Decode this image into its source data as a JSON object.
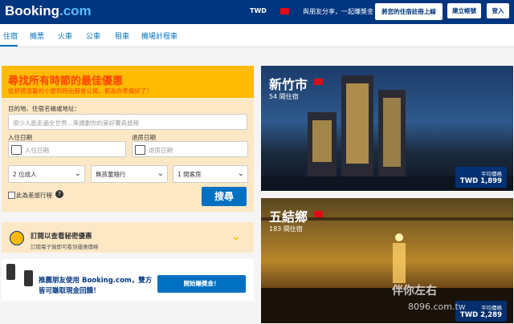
{
  "header": {
    "logo_text": "Booking",
    "logo_suffix": ".com",
    "currency": "TWD",
    "share_text": "與朋友分享，一起賺獎金",
    "list_property": "將您的住宿註冊上線",
    "register": "建立帳號",
    "login": "登入"
  },
  "nav": {
    "tabs": [
      "住宿",
      "機票",
      "火車",
      "公車",
      "租車",
      "機場計程車"
    ]
  },
  "search": {
    "title": "尋找所有時節的最佳優惠",
    "subtitle": "從舒適溫馨的小屋到時尚都會公寓，都為你準備好了！",
    "destination_label": "目的地、住宿名稱或地址：",
    "destination_placeholder": "很少人能走遍全世界...來規劃你的美好驚奇旅程",
    "checkin_label": "入住日期",
    "checkin_placeholder": "入住日期",
    "checkout_label": "退房日期",
    "checkout_placeholder": "退房日期",
    "adults": "2 位成人",
    "children": "無孩童隨行",
    "rooms": "1 間客房",
    "business_trip": "此為差旅行程",
    "search_button": "搜尋"
  },
  "subscribe": {
    "title": "訂閱以查看秘密優惠",
    "desc": "訂閱電子報即可看到優惠價格"
  },
  "referral": {
    "text_line1": "推薦朋友使用 Booking.com，雙方",
    "text_line2": "皆可賺取現金回饋！",
    "button": "開始賺獎金！"
  },
  "destinations": [
    {
      "city": "新竹市",
      "count": "54 間住宿",
      "price_label": "平均價格",
      "price": "TWD 1,899"
    },
    {
      "city": "五結鄉",
      "count": "183 間住宿",
      "price_label": "平均價格",
      "price": "TWD 2,289"
    }
  ],
  "watermark": {
    "text1": "伴你左右",
    "text2": "8096.com.tw"
  },
  "colors": {
    "brand": "#003580",
    "accent": "#febb02",
    "button": "#0071c2"
  }
}
